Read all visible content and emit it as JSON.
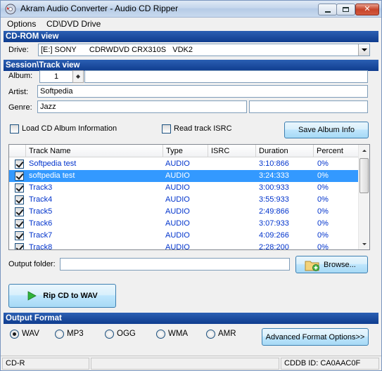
{
  "window": {
    "title": "Akram Audio Converter - Audio CD Ripper"
  },
  "menu": [
    "Options",
    "CD\\DVD Drive"
  ],
  "cdrom": {
    "section_title": "CD-ROM view",
    "drive_label": "Drive:",
    "drive_value": "[E:] SONY      CDRWDVD CRX310S   VDK2"
  },
  "session": {
    "section_title": "Session\\Track view",
    "album_label": "Album:",
    "album_number": "1",
    "album_name": "",
    "artist_label": "Artist:",
    "artist_value": "Softpedia",
    "genre_label": "Genre:",
    "genre_value": "Jazz",
    "genre_extra": "",
    "genre_extra2": "",
    "load_info_label": "Load CD Album Information",
    "read_isrc_label": "Read track ISRC",
    "save_album_label": "Save Album Info"
  },
  "tracks": {
    "headers": [
      "Track Name",
      "Type",
      "ISRC",
      "Duration",
      "Percent"
    ],
    "rows": [
      {
        "name": "Softpedia test",
        "type": "AUDIO",
        "isrc": "",
        "duration": "3:10:866",
        "percent": "0%",
        "checked": true,
        "selected": false
      },
      {
        "name": "softpedia test",
        "type": "AUDIO",
        "isrc": "",
        "duration": "3:24:333",
        "percent": "0%",
        "checked": true,
        "selected": true
      },
      {
        "name": "Track3",
        "type": "AUDIO",
        "isrc": "",
        "duration": "3:00:933",
        "percent": "0%",
        "checked": true,
        "selected": false
      },
      {
        "name": "Track4",
        "type": "AUDIO",
        "isrc": "",
        "duration": "3:55:933",
        "percent": "0%",
        "checked": true,
        "selected": false
      },
      {
        "name": "Track5",
        "type": "AUDIO",
        "isrc": "",
        "duration": "2:49:866",
        "percent": "0%",
        "checked": true,
        "selected": false
      },
      {
        "name": "Track6",
        "type": "AUDIO",
        "isrc": "",
        "duration": "3:07:933",
        "percent": "0%",
        "checked": true,
        "selected": false
      },
      {
        "name": "Track7",
        "type": "AUDIO",
        "isrc": "",
        "duration": "4:09:266",
        "percent": "0%",
        "checked": true,
        "selected": false
      },
      {
        "name": "Track8",
        "type": "AUDIO",
        "isrc": "",
        "duration": "2:28:200",
        "percent": "0%",
        "checked": true,
        "selected": false
      }
    ]
  },
  "output": {
    "folder_label": "Output folder:",
    "folder_value": "",
    "browse_label": "Browse...",
    "rip_label": "Rip CD to WAV"
  },
  "format": {
    "section_title": "Output Format",
    "options": [
      "WAV",
      "MP3",
      "OGG",
      "WMA",
      "AMR"
    ],
    "selected": "WAV",
    "advanced_label": "Advanced Format Options>>"
  },
  "status": {
    "left": "CD-R",
    "middle": "",
    "right": "CDDB ID: CA0AAC0F"
  },
  "colors": {
    "section_bar": "#0f3c8e",
    "selection": "#3399ff",
    "track_text": "#0033cc"
  }
}
